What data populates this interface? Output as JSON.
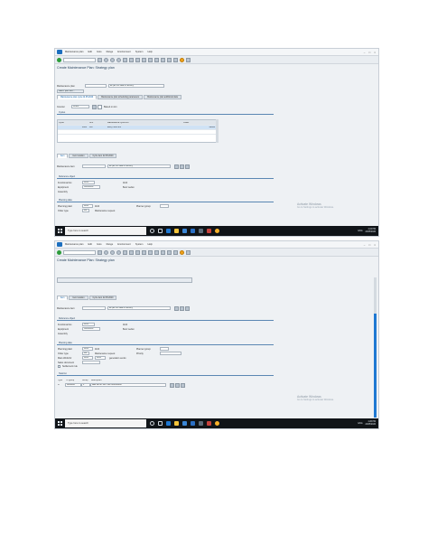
{
  "menu": [
    "Maintenance plan",
    "Edit",
    "Goto",
    "Range",
    "Environment",
    "System",
    "Help"
  ],
  "title": "Create Maintenance Plan: Strategy plan",
  "shot1": {
    "maintenance_plan_label": "Maintenance plan",
    "maintenance_plan_desc": "as per km base of activity",
    "maint_plan_hierarchy_button": "Maint. plan hier...",
    "tabs": [
      "Maintenance plan cycle 22.05.2020",
      "Maintenance plan scheduling parameters",
      "Maintenance plan additional data"
    ],
    "counter_label": "Counter",
    "counter_value": "11484",
    "based_on_km_label": "Based on km",
    "cycles_section": "Cycles",
    "cycle_table": {
      "headers": [
        "Cycle",
        "Unit",
        "Maintenance cycle text",
        "Offset"
      ],
      "rows": [
        [
          "5000",
          "KM",
          "every 5000 km",
          "20000"
        ]
      ]
    },
    "item_tabs": [
      "Item",
      "Item location",
      "Cycle item 22.05.2020"
    ],
    "maintenance_item_label": "Maintenance item",
    "maintenance_item_desc": "as per km base of activity",
    "reference_object_section": "Reference object",
    "functional_loc_label": "Functional loc.",
    "functional_loc_value": "1104",
    "functional_loc_text": "1104",
    "equipment_label": "Equipment",
    "equipment_value": "30030038",
    "equipment_text": "Benz sedan",
    "assembly_label": "Assembly",
    "planning_data_section": "Planning data",
    "planning_plant_label": "Planning plant",
    "planning_plant_value": "1104",
    "planning_plant_text": "1104",
    "planner_group_label": "Planner group",
    "order_type_label": "Order type",
    "order_type_value": "M1",
    "order_type_text": "Maintenance request",
    "activate_windows_title": "Activate Windows",
    "activate_windows_text": "Go to Settings to activate Windows.",
    "taskbar": {
      "search": "Type here to search",
      "lang": "ENG",
      "time": "4:24 PM",
      "date": "22/05/2020"
    }
  },
  "shot2": {
    "item_tabs": [
      "Item",
      "Item location",
      "Cycle item 22.05.2020"
    ],
    "maintenance_item_label": "Maintenance item",
    "maintenance_item_desc": "as per km base of activity",
    "reference_object_section": "Reference object",
    "functional_loc_label": "Functional loc.",
    "functional_loc_value": "1104",
    "functional_loc_text": "1104",
    "equipment_label": "Equipment",
    "equipment_value": "30030038",
    "equipment_text": "Benz sedan",
    "assembly_label": "Assembly",
    "planning_data_section": "Planning data",
    "planning_plant_label": "Planning plant",
    "planning_plant_value": "1104",
    "planning_plant_text": "1104",
    "planner_group_label": "Planner group",
    "order_type_label": "Order type",
    "order_type_value": "M1",
    "order_type_text": "Maintenance request",
    "priority_label": "Priority",
    "main_workctr_label": "Main WorkCtr",
    "main_workctr_value": "1104",
    "main_workctr_text": "1104",
    "generation_label": "generation vendo",
    "sales_document_label": "Sales document",
    "settlement_rule_label": "Settlement rule",
    "task_list_section": "Task list",
    "task_list_headers": [
      "Type",
      "TL group",
      "Group",
      "Description"
    ],
    "task_list_row": [
      "A",
      "8000128",
      "1",
      "task list for veh. 001-000048000"
    ],
    "activate_windows_title": "Activate Windows",
    "activate_windows_text": "Go to Settings to activate Windows.",
    "taskbar": {
      "search": "Type here to search",
      "lang": "ENG",
      "time": "4:26 PM",
      "date": "22/05/2020"
    }
  },
  "colors": {
    "accent": "#1e78d2",
    "title": "#1f3b57",
    "taskbar": "#101418"
  }
}
